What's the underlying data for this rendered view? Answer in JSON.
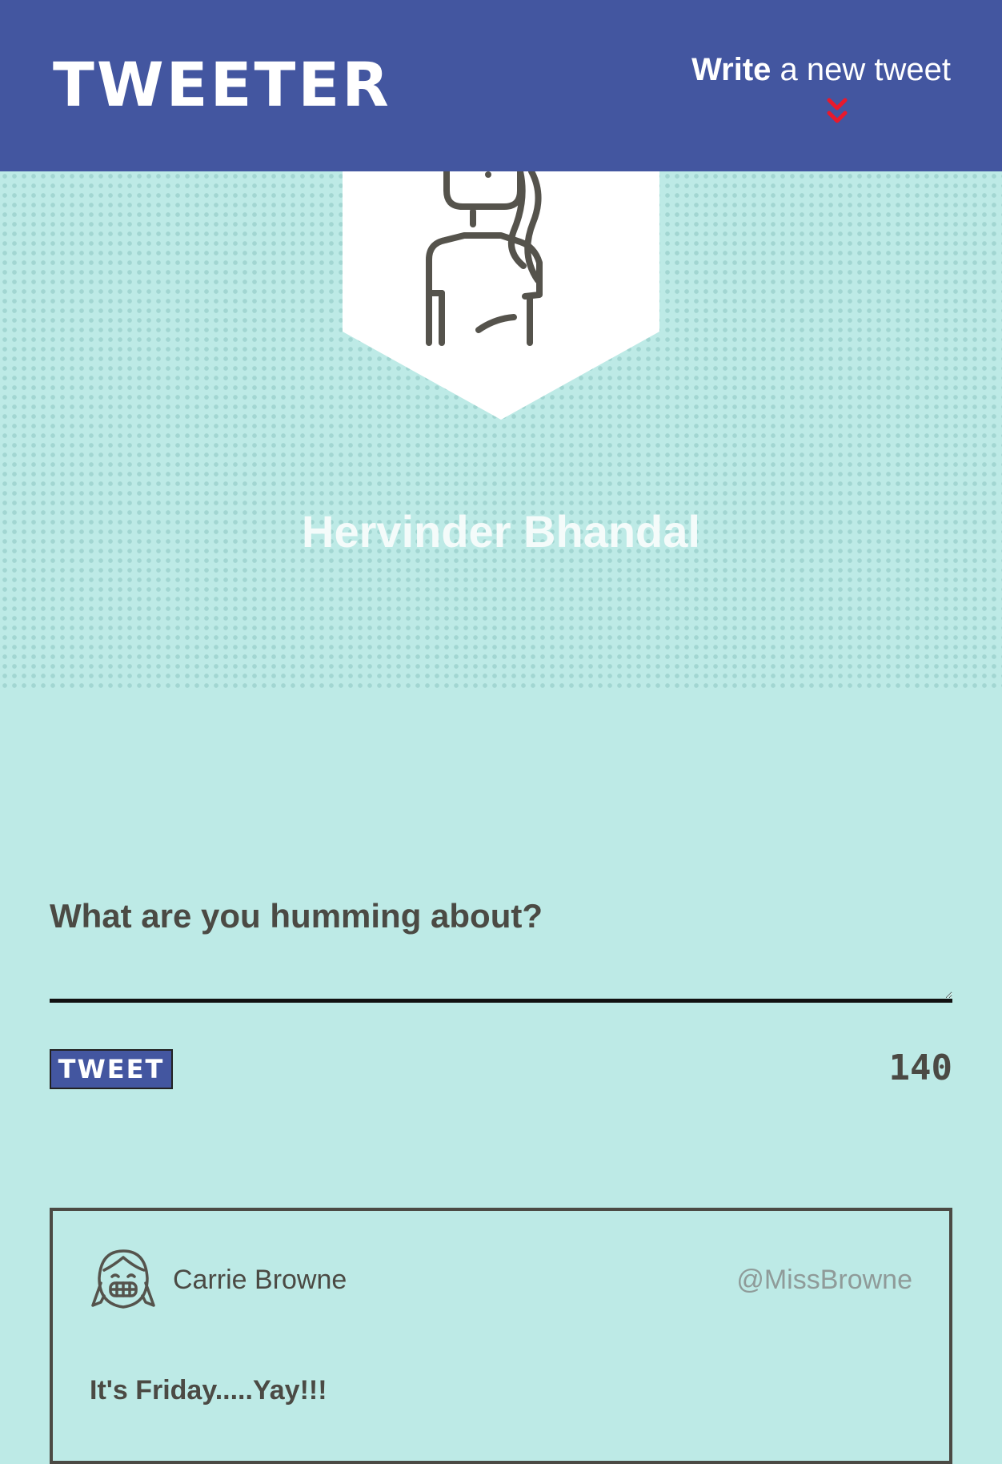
{
  "app": {
    "title": "TWEETER"
  },
  "nav": {
    "compose_strong": "Write",
    "compose_rest": " a new tweet",
    "icons": {
      "toggle": "double-chevron-down-icon"
    },
    "colors": {
      "bar": "#4356a0",
      "chevron": "#e8192c"
    }
  },
  "profile": {
    "name": "Hervinder Bhandal",
    "avatar_icon": "woman-avatar-icon"
  },
  "composer": {
    "label": "What are you humming about?",
    "value": "",
    "button_label": "TWEET",
    "counter": "140"
  },
  "tweets": [
    {
      "name": "Carrie Browne",
      "handle": "@MissBrowne",
      "text": "It's Friday.....Yay!!!",
      "avatar_icon": "girl-avatar-icon"
    }
  ]
}
